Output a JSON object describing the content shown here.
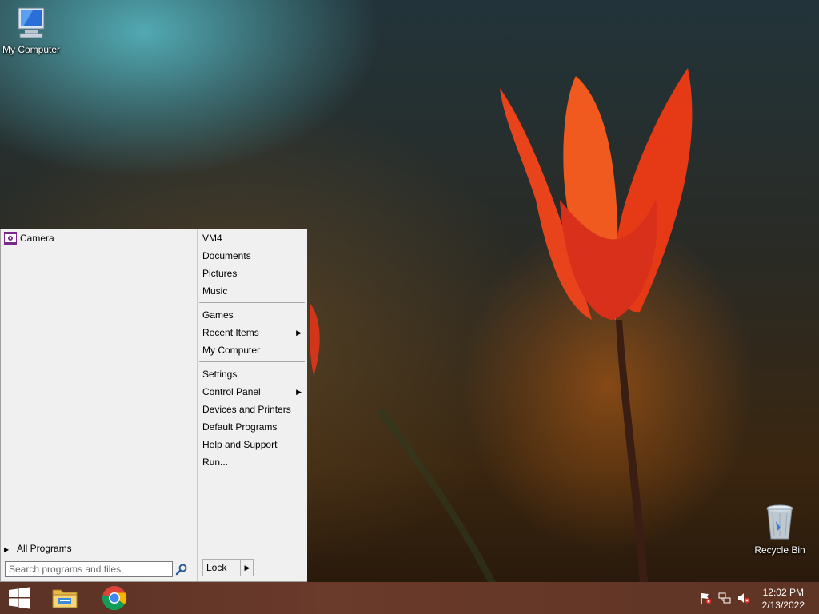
{
  "desktop": {
    "icons": [
      {
        "label": "My Computer",
        "icon": "computer-icon"
      },
      {
        "label": "Recycle Bin",
        "icon": "recycle-bin-icon"
      }
    ]
  },
  "start_menu": {
    "programs": [
      {
        "label": "Camera",
        "icon": "camera-icon"
      }
    ],
    "all_programs_label": "All Programs",
    "search_placeholder": "Search programs and files",
    "right_items": [
      {
        "label": "VM4"
      },
      {
        "label": "Documents"
      },
      {
        "label": "Pictures"
      },
      {
        "label": "Music"
      },
      {
        "label": "Games"
      },
      {
        "label": "Recent Items",
        "submenu": true
      },
      {
        "label": "My Computer"
      },
      {
        "label": "Settings"
      },
      {
        "label": "Control Panel",
        "submenu": true
      },
      {
        "label": "Devices and Printers"
      },
      {
        "label": "Default Programs"
      },
      {
        "label": "Help and Support"
      },
      {
        "label": "Run..."
      }
    ],
    "lock_label": "Lock"
  },
  "taskbar": {
    "start_icon": "windows-logo-icon",
    "pinned": [
      {
        "icon": "file-explorer-icon"
      },
      {
        "icon": "chrome-icon"
      }
    ],
    "tray": [
      {
        "icon": "action-center-flag-icon"
      },
      {
        "icon": "network-icon"
      },
      {
        "icon": "volume-muted-icon"
      }
    ],
    "clock": {
      "time": "12:02 PM",
      "date": "2/13/2022"
    }
  },
  "colors": {
    "menu_bg": "#f0f0f0",
    "taskbar_bg": "#5e3424",
    "accent_purple": "#7a2a8a"
  }
}
